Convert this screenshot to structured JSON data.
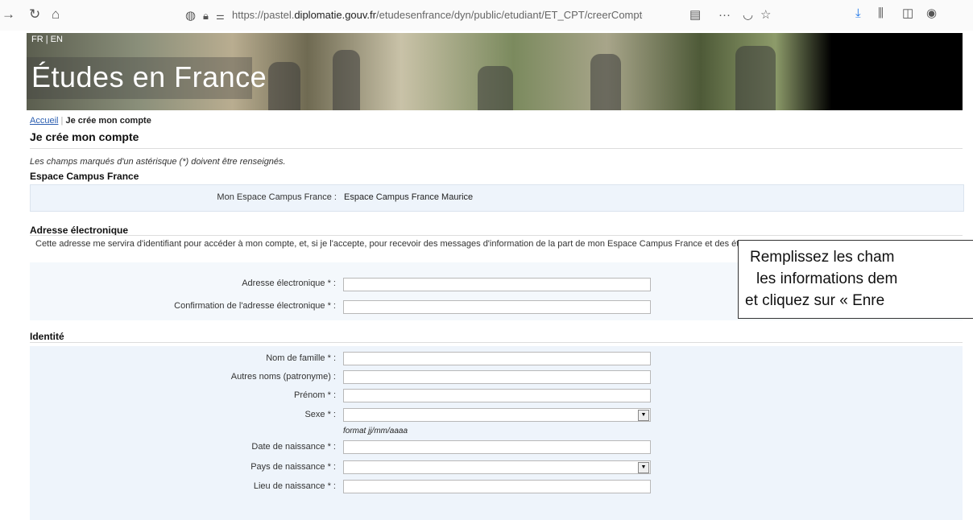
{
  "browser": {
    "url_prefix": "https://pastel.",
    "url_domain": "diplomatie.gouv.fr",
    "url_path": "/etudesenfrance/dyn/public/etudiant/ET_CPT/creerCompteC"
  },
  "banner": {
    "lang_links": "FR | EN",
    "title": "Études en France"
  },
  "breadcrumb": {
    "home": "Accueil",
    "current": "Je crée mon compte"
  },
  "page": {
    "title": "Je crée mon compte",
    "required_note": "Les champs marqués d'un astérisque (*) doivent être renseignés."
  },
  "campus": {
    "title": "Espace Campus France",
    "label": "Mon Espace Campus France :",
    "value": "Espace Campus France Maurice"
  },
  "email_section": {
    "title": "Adresse électronique",
    "description": "Cette adresse me servira d'identifiant pour accéder à mon compte, et, si je l'accepte, pour recevoir des messages d'information de la part de mon Espace Campus France et des établissements auprès desquels je souhaite candidater.",
    "email_label": "Adresse électronique * :",
    "email_confirm_label": "Confirmation de l'adresse électronique * :"
  },
  "identity": {
    "title": "Identité",
    "last_name_label": "Nom de famille * :",
    "other_names_label": "Autres noms (patronyme) :",
    "first_name_label": "Prénom * :",
    "sex_label": "Sexe * :",
    "date_hint": "format jj/mm/aaaa",
    "birth_date_label": "Date de naissance * :",
    "birth_country_label": "Pays de naissance * :",
    "birth_place_label": "Lieu de naissance * :"
  },
  "callout": {
    "line1": "Remplissez les cham",
    "line2": "les informations dem",
    "line3": "et cliquez sur « Enre"
  }
}
